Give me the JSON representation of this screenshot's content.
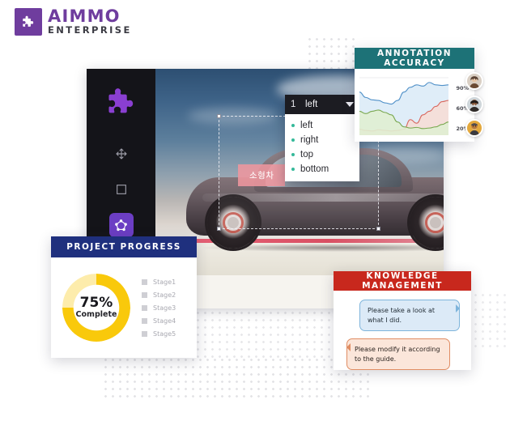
{
  "brand": {
    "name": "AIMMO",
    "subtitle": "ENTERPRISE",
    "mark_icon": "puzzle-piece-icon",
    "color": "#6f3d9e"
  },
  "workspace": {
    "rail_logo_icon": "puzzle-piece-icon",
    "tools": [
      {
        "id": "move",
        "icon": "move-arrows-icon",
        "active": false
      },
      {
        "id": "bounding-box",
        "icon": "rectangle-icon",
        "active": false
      },
      {
        "id": "polygon",
        "icon": "polygon-icon",
        "active": true
      },
      {
        "id": "segmentation",
        "icon": "overlap-shapes-icon",
        "active": false
      }
    ],
    "annotation_label": "소형차",
    "selection_handles": 4
  },
  "dropdown": {
    "index": "1",
    "selected": "left",
    "caret_icon": "chevron-down-icon",
    "options": [
      "left",
      "right",
      "top",
      "bottom"
    ]
  },
  "cards": {
    "accuracy": {
      "title": "ANNOTATION ACCURACY",
      "header_color": "#1d7277",
      "y_ticks": [
        "90%",
        "60%",
        "20%"
      ],
      "avatars": [
        "avatar-user-1",
        "avatar-user-2",
        "avatar-user-3"
      ]
    },
    "progress": {
      "title": "PROJECT PROGRESS",
      "header_color": "#1f307e",
      "percent": "75%",
      "percent_caption": "Complete",
      "percent_value": 75,
      "stages": [
        "Stage1",
        "Stage2",
        "Stage3",
        "Stage4",
        "Stage5"
      ]
    },
    "knowledge": {
      "title": "KNOWLEDGE MANAGEMENT",
      "header_color": "#c8281d",
      "messages": [
        {
          "direction": "incoming",
          "text": "Please take a look at what I did."
        },
        {
          "direction": "outgoing",
          "text": "Please modify it according to the guide."
        }
      ]
    }
  },
  "chart_data": {
    "type": "area",
    "title": "ANNOTATION ACCURACY",
    "xlabel": "",
    "ylabel": "",
    "ylim": [
      0,
      100
    ],
    "grid": false,
    "legend": "none",
    "tick_labels": [
      "90%",
      "60%",
      "20%"
    ],
    "x": [
      0,
      1,
      2,
      3,
      4,
      5,
      6,
      7,
      8,
      9,
      10,
      11,
      12,
      13,
      14
    ],
    "series": [
      {
        "name": "Blue",
        "color": "#4f90c8",
        "fill": "#dcebf7",
        "values": [
          72,
          63,
          59,
          58,
          54,
          52,
          58,
          72,
          80,
          84,
          82,
          88,
          84,
          83,
          84
        ]
      },
      {
        "name": "Red",
        "color": "#d9685f",
        "fill": "#f6ddd6",
        "values": [
          10,
          8,
          7,
          9,
          8,
          7,
          8,
          10,
          26,
          20,
          34,
          40,
          48,
          56,
          58
        ]
      },
      {
        "name": "Green",
        "color": "#7aa850",
        "fill": "#e0eed2",
        "values": [
          40,
          36,
          40,
          42,
          38,
          34,
          22,
          14,
          12,
          13,
          11,
          12,
          14,
          18,
          22
        ]
      }
    ]
  }
}
